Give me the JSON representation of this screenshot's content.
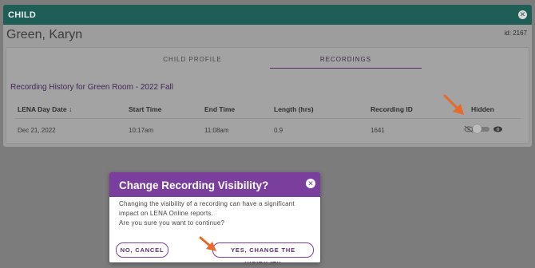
{
  "panel": {
    "title": "CHILD",
    "child_name": "Green, Karyn",
    "child_id": "id: 2167"
  },
  "tabs": [
    {
      "label": "CHILD PROFILE"
    },
    {
      "label": "RECORDINGS"
    }
  ],
  "history_title": "Recording History for Green Room - 2022 Fall",
  "table": {
    "columns": [
      "LENA Day Date",
      "Start Time",
      "End Time",
      "Length (hrs)",
      "Recording ID",
      "Hidden"
    ],
    "sort_indicator": "↓",
    "rows": [
      {
        "date": "Dec 21, 2022",
        "start": "10:17am",
        "end": "11:08am",
        "length": "0.9",
        "id": "1641"
      }
    ]
  },
  "modal": {
    "title": "Change Recording Visibility?",
    "body_lines": [
      "Changing the visibility of a recording can have a significant",
      "impact on LENA Online reports.",
      "Are you sure you want to continue?"
    ],
    "cancel_label": "NO, CANCEL",
    "confirm_label": "YES, CHANGE THE VISIBILITY"
  },
  "icons": {
    "close": "close-icon",
    "eye_off": "eye-off-icon",
    "eye": "eye-icon",
    "annotation_arrow": "arrow-icon"
  },
  "colors": {
    "header_teal": "#1f5e56",
    "modal_purple": "#7a3f9d",
    "annotation_orange": "#e8692a"
  }
}
